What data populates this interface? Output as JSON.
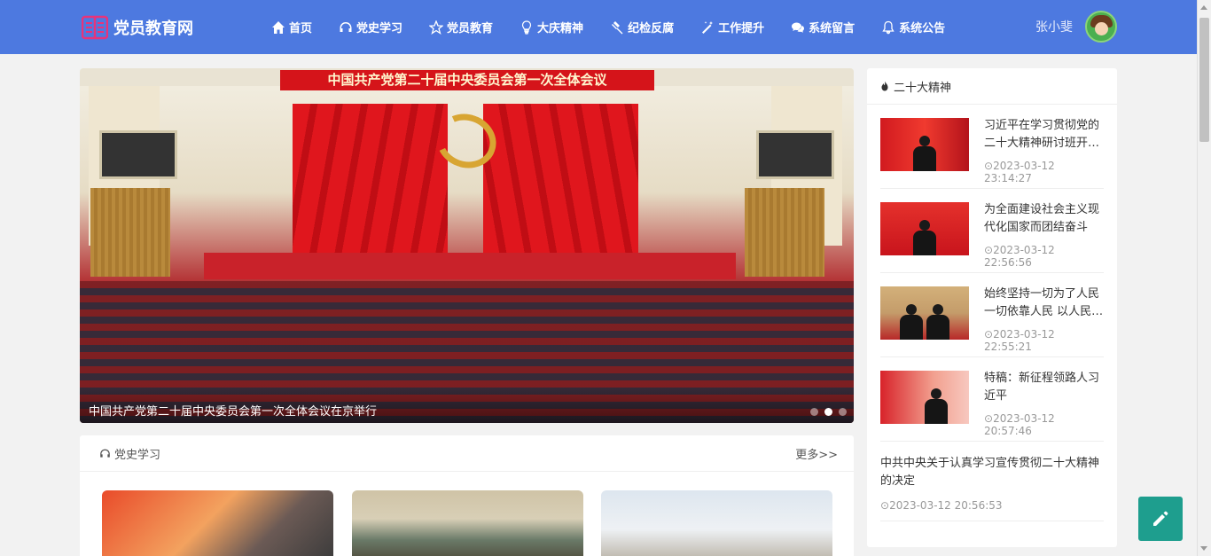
{
  "brand": {
    "name": "党员教育网",
    "icon": "book-icon"
  },
  "nav": [
    {
      "label": "首页",
      "icon": "home-icon"
    },
    {
      "label": "党史学习",
      "icon": "headphones-icon"
    },
    {
      "label": "党员教育",
      "icon": "star-icon"
    },
    {
      "label": "大庆精神",
      "icon": "lightbulb-icon"
    },
    {
      "label": "纪检反腐",
      "icon": "gavel-icon"
    },
    {
      "label": "工作提升",
      "icon": "magic-wand-icon"
    },
    {
      "label": "系统留言",
      "icon": "chat-icon"
    },
    {
      "label": "系统公告",
      "icon": "bell-icon"
    }
  ],
  "user": {
    "name": "张小斐",
    "avatar": "avatar-icon"
  },
  "carousel": {
    "banner_text": "中国共产党第二十届中央委员会第一次全体会议",
    "caption": "中国共产党第二十届中央委员会第一次全体会议在京举行",
    "slide_count": 3,
    "active_slide": 2
  },
  "section": {
    "title": "党史学习",
    "icon": "headphones-icon",
    "more_label": "更多>>"
  },
  "sidebar": {
    "title": "二十大精神",
    "icon": "fire-icon",
    "items": [
      {
        "title": "习近平在学习贯彻党的二十大精神研讨班开班式上发表重要讲话",
        "time": "2023-03-12 23:14:27"
      },
      {
        "title": "为全面建设社会主义现代化国家而团结奋斗",
        "time": "2023-03-12 22:56:56"
      },
      {
        "title": "始终坚持一切为了人民一切依靠人民 以人民为中心",
        "time": "2023-03-12 22:55:21"
      },
      {
        "title": "特稿：新征程领路人习近平",
        "time": "2023-03-12 20:57:46"
      },
      {
        "title": "中共中央关于认真学习宣传贯彻二十大精神的决定",
        "time": "2023-03-12 20:56:53"
      }
    ]
  },
  "actions": {
    "edit": "pencil-icon"
  },
  "colors": {
    "navbar": "#4d79e0",
    "edit_button": "#1e9e8e",
    "banner_red": "#d5141a"
  }
}
